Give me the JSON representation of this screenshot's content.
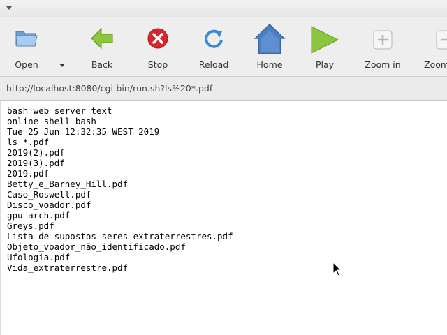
{
  "toolbar": {
    "buttons": [
      {
        "label": "Open",
        "icon": "folder-icon"
      },
      {
        "label": "Back",
        "icon": "back-arrow-icon"
      },
      {
        "label": "Stop",
        "icon": "stop-icon"
      },
      {
        "label": "Reload",
        "icon": "reload-icon"
      },
      {
        "label": "Home",
        "icon": "home-icon"
      },
      {
        "label": "Play",
        "icon": "play-icon"
      },
      {
        "label": "Zoom in",
        "icon": "zoom-in-icon"
      },
      {
        "label": "Zoom",
        "icon": "zoom-out-icon"
      }
    ]
  },
  "address": {
    "url": "http://localhost:8080/cgi-bin/run.sh?ls%20*.pdf"
  },
  "page": {
    "lines": [
      "bash web server text",
      "online shell bash",
      "Tue 25 Jun 12:32:35 WEST 2019",
      "ls *.pdf",
      "2019(2).pdf",
      "2019(3).pdf",
      "2019.pdf",
      "Betty_e_Barney_Hill.pdf",
      "Caso_Roswell.pdf",
      "Disco_voador.pdf",
      "gpu-arch.pdf",
      "Greys.pdf",
      "Lista_de_supostos_seres_extraterrestres.pdf",
      "Objeto_voador_não_identificado.pdf",
      "Ufologia.pdf",
      "Vida_extraterrestre.pdf"
    ]
  },
  "colors": {
    "accent_green": "#7cb82f",
    "stop_red": "#d9262c",
    "home_blue": "#4a7fc4",
    "reload_blue": "#3a8ad8"
  }
}
